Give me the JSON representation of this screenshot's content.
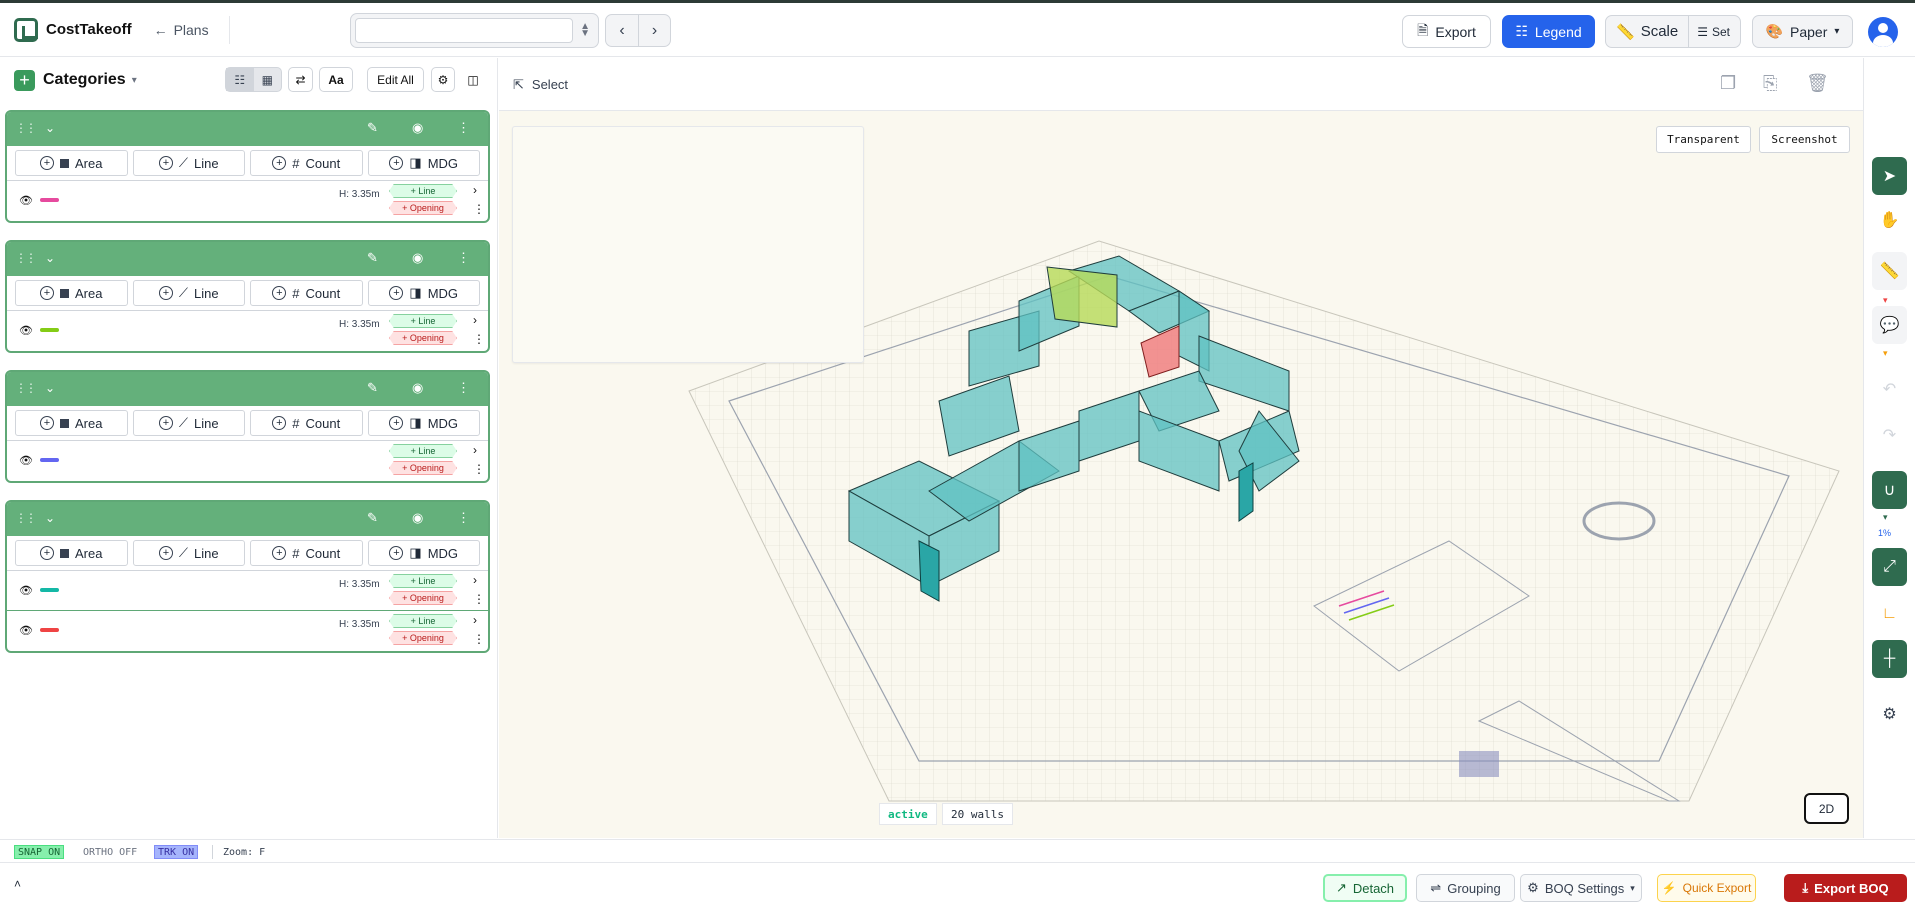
{
  "app": {
    "name": "CostTakeoff",
    "back_label": "Plans"
  },
  "toolbar": {
    "export_label": "Export",
    "legend_label": "Legend",
    "scale_label": "Scale",
    "set_label": "Set",
    "paper_label": "Paper"
  },
  "sidebar": {
    "title": "Categories",
    "edit_all_label": "Edit All",
    "font_label": "Aa",
    "categories": [
      {
        "tools": [
          "Area",
          "Line",
          "Count",
          "MDG"
        ],
        "items": [
          {
            "color": "#e64a9e",
            "height": "H: 3.35m"
          }
        ]
      },
      {
        "tools": [
          "Area",
          "Line",
          "Count",
          "MDG"
        ],
        "items": [
          {
            "color": "#84cc16",
            "height": "H: 3.35m"
          }
        ]
      },
      {
        "tools": [
          "Area",
          "Line",
          "Count",
          "MDG"
        ],
        "items": [
          {
            "color": "#6366f1",
            "height": ""
          }
        ]
      },
      {
        "tools": [
          "Area",
          "Line",
          "Count",
          "MDG"
        ],
        "items": [
          {
            "color": "#14b8a6",
            "height": "H: 3.35m"
          },
          {
            "color": "#ef4444",
            "height": "H: 3.35m"
          }
        ]
      }
    ],
    "add_line_label": "+ Line",
    "add_opening_label": "+ Opening"
  },
  "main": {
    "select_label": "Select",
    "transparent_label": "Transparent",
    "screenshot_label": "Screenshot",
    "view_2d_label": "2D",
    "status_active": "active",
    "status_walls": "20 walls"
  },
  "snapbar": {
    "snap": "SNAP ON",
    "ortho": "ORTHO OFF",
    "trk": "TRK ON",
    "zoom": "Zoom: F"
  },
  "right_tools": {
    "zoom_percent": "1%"
  },
  "bottom": {
    "detach": "Detach",
    "grouping": "Grouping",
    "boq_settings": "BOQ Settings",
    "quick_export": "Quick Export",
    "export_boq": "Export BOQ"
  },
  "colors": {
    "brand_green": "#2f6b4f",
    "card_green": "#64b07b",
    "legend_blue": "#2563eb",
    "export_red": "#b91c1c",
    "wall_teal": "#5fc2c2"
  }
}
